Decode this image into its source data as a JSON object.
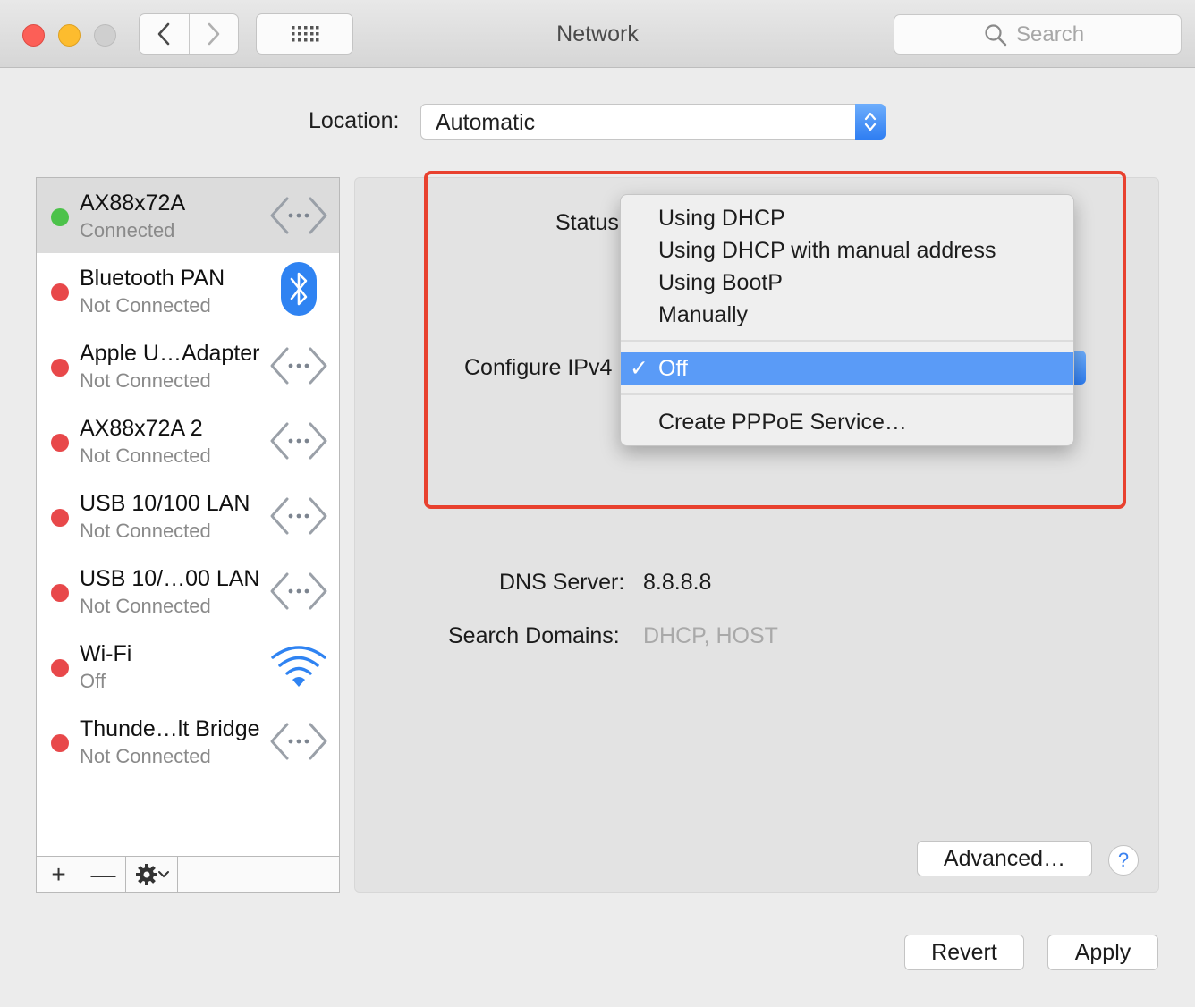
{
  "window": {
    "title": "Network"
  },
  "toolbar": {
    "search_placeholder": "Search"
  },
  "location": {
    "label": "Location:",
    "value": "Automatic"
  },
  "services": [
    {
      "name": "AX88x72A",
      "status": "Connected",
      "dot_color": "#4cc24a",
      "icon": "ethernet-icon",
      "selected": true
    },
    {
      "name": "Bluetooth PAN",
      "status": "Not Connected",
      "dot_color": "#e8484a",
      "icon": "bluetooth-icon"
    },
    {
      "name": "Apple U…Adapter",
      "status": "Not Connected",
      "dot_color": "#e8484a",
      "icon": "ethernet-icon"
    },
    {
      "name": "AX88x72A 2",
      "status": "Not Connected",
      "dot_color": "#e8484a",
      "icon": "ethernet-icon"
    },
    {
      "name": "USB 10/100 LAN",
      "status": "Not Connected",
      "dot_color": "#e8484a",
      "icon": "ethernet-icon"
    },
    {
      "name": "USB 10/…00 LAN",
      "status": "Not Connected",
      "dot_color": "#e8484a",
      "icon": "ethernet-icon"
    },
    {
      "name": "Wi-Fi",
      "status": "Off",
      "dot_color": "#e8484a",
      "icon": "wifi-icon"
    },
    {
      "name": "Thunde…lt Bridge",
      "status": "Not Connected",
      "dot_color": "#e8484a",
      "icon": "ethernet-icon"
    }
  ],
  "sidebar_tools": {
    "add": "+",
    "remove": "—"
  },
  "detail": {
    "status_label": "Status",
    "configure_label": "Configure IPv4",
    "dns_label": "DNS Server:",
    "dns_value": "8.8.8.8",
    "search_domains_label": "Search Domains:",
    "search_domains_value": "DHCP, HOST"
  },
  "configure_menu": {
    "items": [
      "Using DHCP",
      "Using DHCP with manual address",
      "Using BootP",
      "Manually"
    ],
    "selected": "Off",
    "check": "✓",
    "extra": "Create PPPoE Service…"
  },
  "buttons": {
    "advanced": "Advanced…",
    "help": "?",
    "revert": "Revert",
    "apply": "Apply"
  },
  "colors": {
    "highlight": "#5a9bf7",
    "annotation_box": "#e8412f",
    "accent": "#2f7ef2"
  }
}
